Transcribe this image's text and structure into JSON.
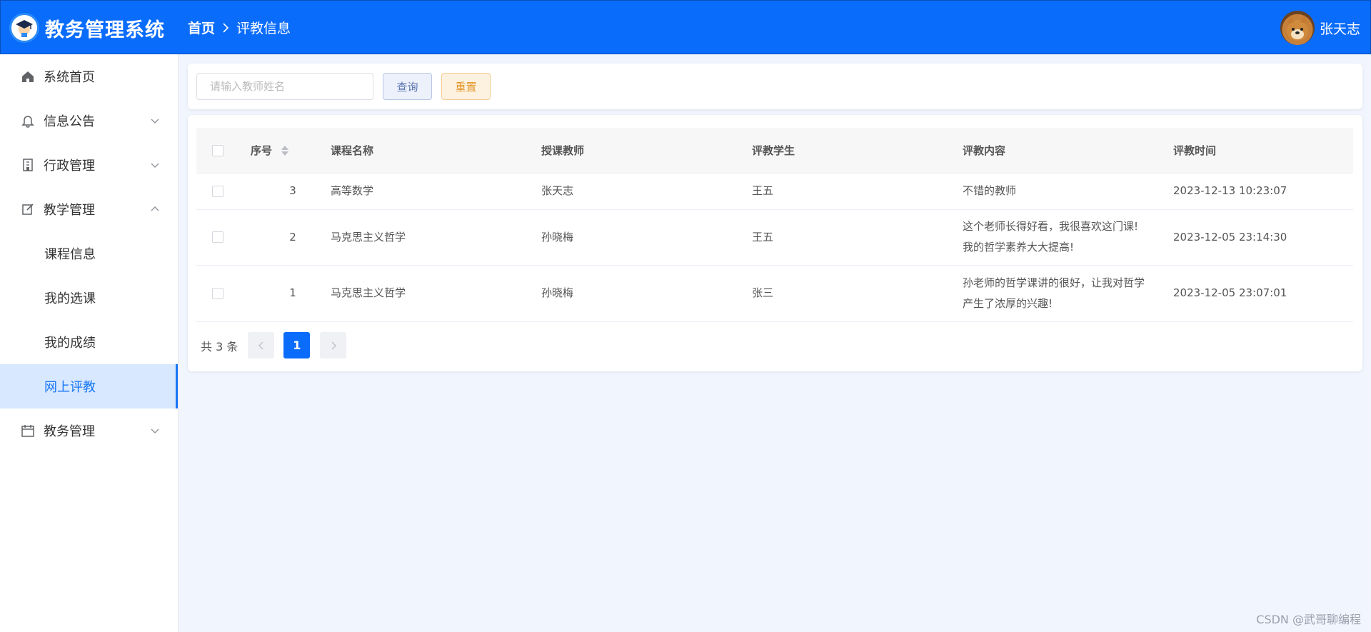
{
  "app": {
    "title": "教务管理系统"
  },
  "breadcrumb": {
    "home": "首页",
    "current": "评教信息"
  },
  "user": {
    "name": "张天志"
  },
  "sidebar": {
    "items": [
      {
        "label": "系统首页",
        "icon": "home-icon"
      },
      {
        "label": "信息公告",
        "icon": "bell-icon",
        "expandable": true
      },
      {
        "label": "行政管理",
        "icon": "building-icon",
        "expandable": true
      },
      {
        "label": "教学管理",
        "icon": "edit-icon",
        "expandable": true,
        "expanded": true
      },
      {
        "label": "课程信息"
      },
      {
        "label": "我的选课"
      },
      {
        "label": "我的成绩"
      },
      {
        "label": "网上评教",
        "active": true
      },
      {
        "label": "教务管理",
        "icon": "calendar-icon",
        "expandable": true
      }
    ]
  },
  "search": {
    "placeholder": "请输入教师姓名",
    "value": "",
    "query_label": "查询",
    "reset_label": "重置"
  },
  "table": {
    "columns": [
      "序号",
      "课程名称",
      "授课教师",
      "评教学生",
      "评教内容",
      "评教时间"
    ],
    "rows": [
      {
        "id": "3",
        "course": "高等数学",
        "teacher": "张天志",
        "student": "王五",
        "content_lines": [
          "不错的教师"
        ],
        "time": "2023-12-13 10:23:07"
      },
      {
        "id": "2",
        "course": "马克思主义哲学",
        "teacher": "孙晓梅",
        "student": "王五",
        "content_lines": [
          "这个老师长得好看，我很喜欢这门课!",
          "我的哲学素养大大提高!"
        ],
        "time": "2023-12-05 23:14:30"
      },
      {
        "id": "1",
        "course": "马克思主义哲学",
        "teacher": "孙晓梅",
        "student": "张三",
        "content_lines": [
          "孙老师的哲学课讲的很好，让我对哲学",
          "产生了浓厚的兴趣!"
        ],
        "time": "2023-12-05 23:07:01"
      }
    ]
  },
  "pagination": {
    "total_label": "共 3 条",
    "current_page": "1"
  },
  "watermark": "CSDN @武哥聊编程",
  "colors": {
    "primary": "#0a6cfb",
    "reset": "#e39525",
    "active_bg": "#d8e8ff"
  }
}
